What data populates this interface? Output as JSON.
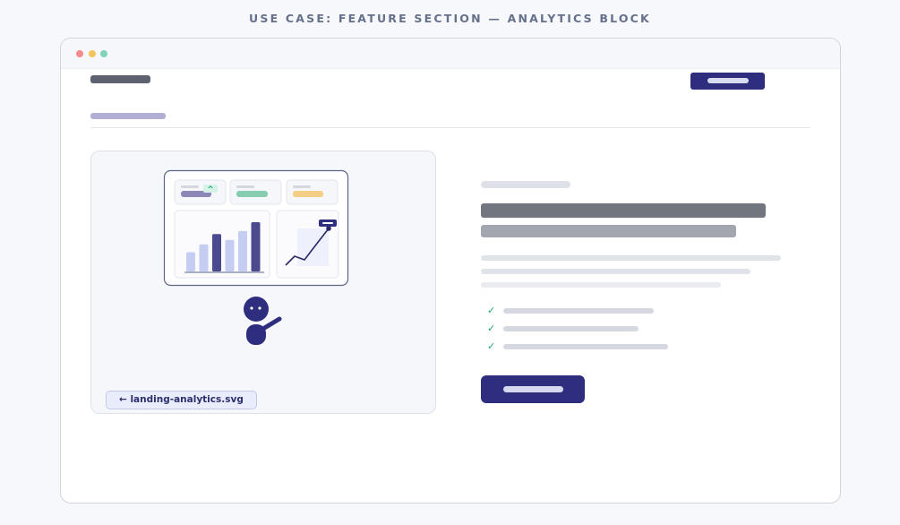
{
  "header": {
    "caption": "USE CASE: FEATURE SECTION — ANALYTICS BLOCK"
  },
  "window": {
    "controls": [
      "close",
      "minimize",
      "maximize"
    ]
  },
  "illustration": {
    "file_label": "← landing-analytics.svg",
    "trend_arrow": "^",
    "bar_values": [
      0.39,
      0.55,
      0.76,
      0.64,
      0.82,
      1.0
    ]
  },
  "feature_list": {
    "check_glyph": "✓"
  },
  "colors": {
    "accent": "#2e2d7e",
    "check": "#1aa37a",
    "dot_close": "#f28b8b",
    "dot_min": "#f4c55c",
    "dot_max": "#7fd3b6"
  }
}
